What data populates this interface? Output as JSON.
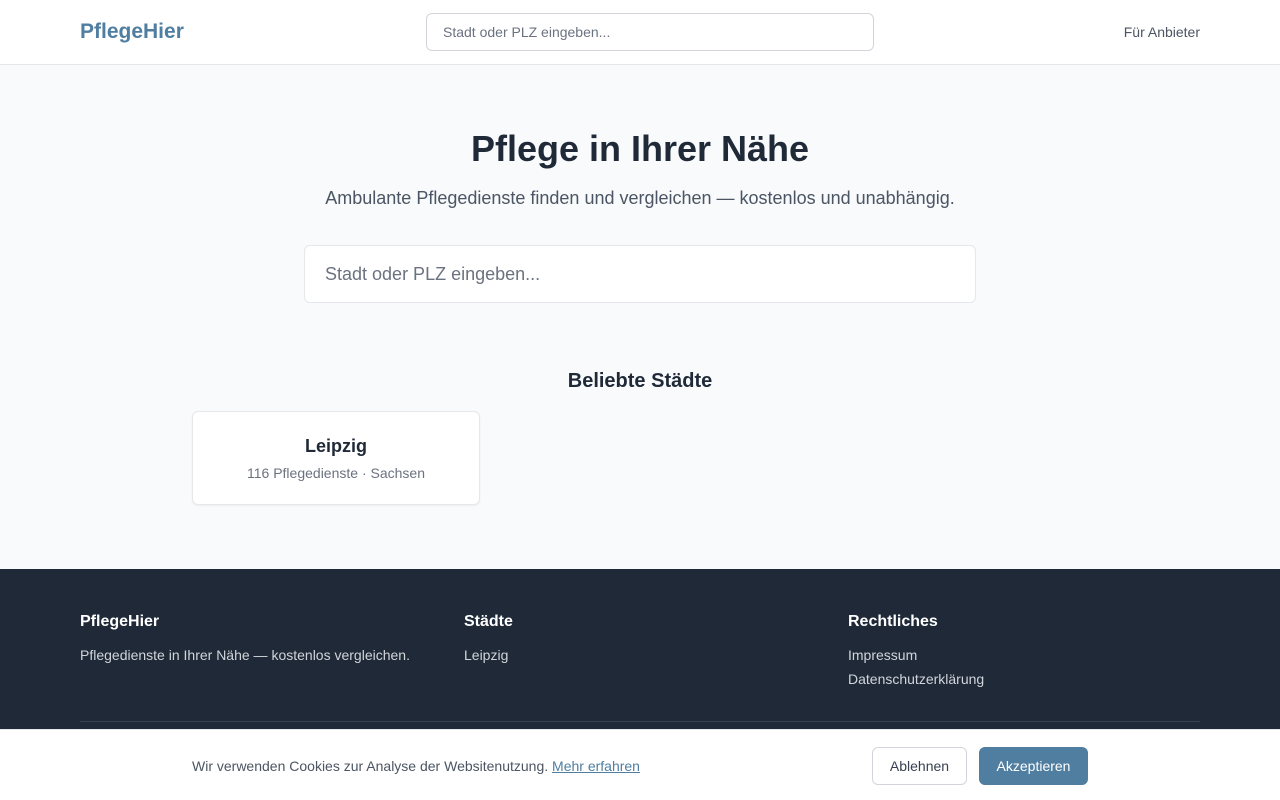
{
  "header": {
    "logo": "PflegeHier",
    "search_placeholder": "Stadt oder PLZ eingeben...",
    "provider_link": "Für Anbieter"
  },
  "hero": {
    "title": "Pflege in Ihrer Nähe",
    "subtitle": "Ambulante Pflegedienste finden und vergleichen — kostenlos und unabhängig.",
    "search_placeholder": "Stadt oder PLZ eingeben..."
  },
  "popular": {
    "title": "Beliebte Städte",
    "cities": [
      {
        "name": "Leipzig",
        "meta": "116 Pflegedienste · Sachsen"
      }
    ]
  },
  "footer": {
    "brand": {
      "title": "PflegeHier",
      "text": "Pflegedienste in Ihrer Nähe — kostenlos vergleichen."
    },
    "cities": {
      "title": "Städte",
      "links": [
        "Leipzig"
      ]
    },
    "legal": {
      "title": "Rechtliches",
      "links": [
        "Impressum",
        "Datenschutzerklärung"
      ]
    }
  },
  "cookie": {
    "text": "Wir verwenden Cookies zur Analyse der Websitenutzung.",
    "link": "Mehr erfahren",
    "reject": "Ablehnen",
    "accept": "Akzeptieren"
  },
  "colors": {
    "brand": "#4f7ea0",
    "footer_bg": "#1f2937",
    "page_bg": "#f8fafc"
  }
}
